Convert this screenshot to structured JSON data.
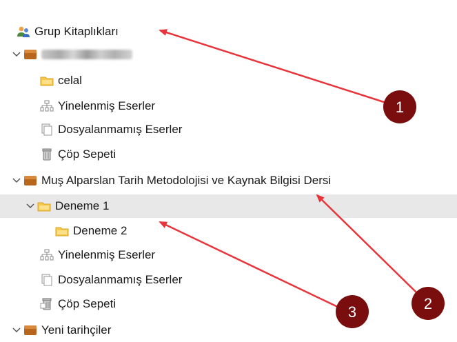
{
  "tree": {
    "group_libraries": "Grup Kitaplıkları",
    "lib1": {
      "name_obscured": "",
      "items": [
        "celal",
        "Yinelenmiş Eserler",
        "Dosyalanmamış Eserler",
        "Çöp Sepeti"
      ]
    },
    "lib2": {
      "name": "Muş Alparslan Tarih Metodolojisi ve Kaynak Bilgisi Dersi",
      "collection": "Deneme 1",
      "subcollection": "Deneme 2",
      "items": [
        "Yinelenmiş Eserler",
        "Dosyalanmamış Eserler",
        "Çöp Sepeti"
      ]
    },
    "lib3": {
      "name": "Yeni tarihçiler"
    }
  },
  "annotations": {
    "badges": [
      "1",
      "2",
      "3"
    ],
    "color": "#7a0d0d",
    "arrow_color": "#e8343a"
  }
}
